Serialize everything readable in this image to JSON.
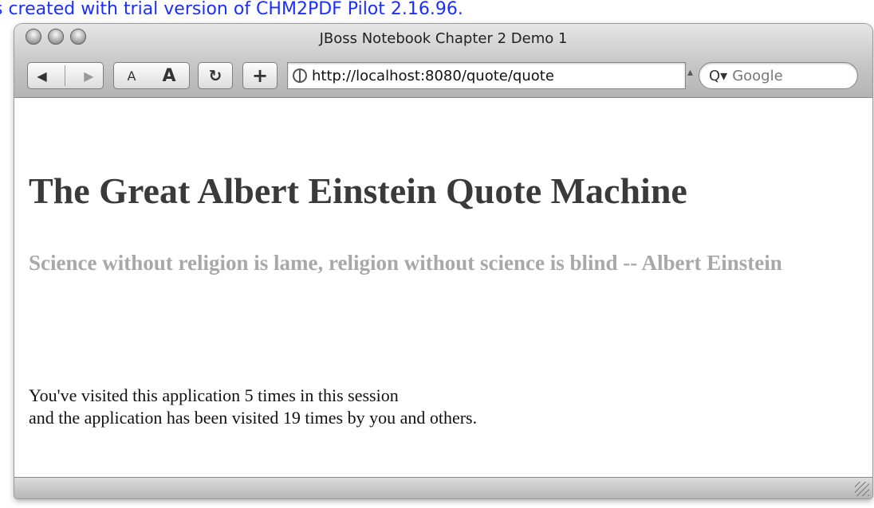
{
  "watermark": "s created with trial version of CHM2PDF Pilot 2.16.96.",
  "window": {
    "title": "JBoss Notebook Chapter 2 Demo 1"
  },
  "toolbar": {
    "back_glyph": "◀",
    "forward_glyph": "▶",
    "text_smaller_label": "A",
    "text_larger_label": "A",
    "reload_glyph": "↻",
    "add_bookmark_glyph": "+"
  },
  "address_bar": {
    "url": "http://localhost:8080/quote/quote"
  },
  "search": {
    "icon_glyph": "Q▾",
    "placeholder": "Google"
  },
  "page": {
    "heading": "The Great Albert Einstein Quote Machine",
    "quote": "Science without religion is lame, religion without science is blind -- Albert Einstein",
    "visits_line1": "You've visited this application 5 times in this session",
    "visits_line2": "and the application has been visited 19 times by you and others."
  }
}
